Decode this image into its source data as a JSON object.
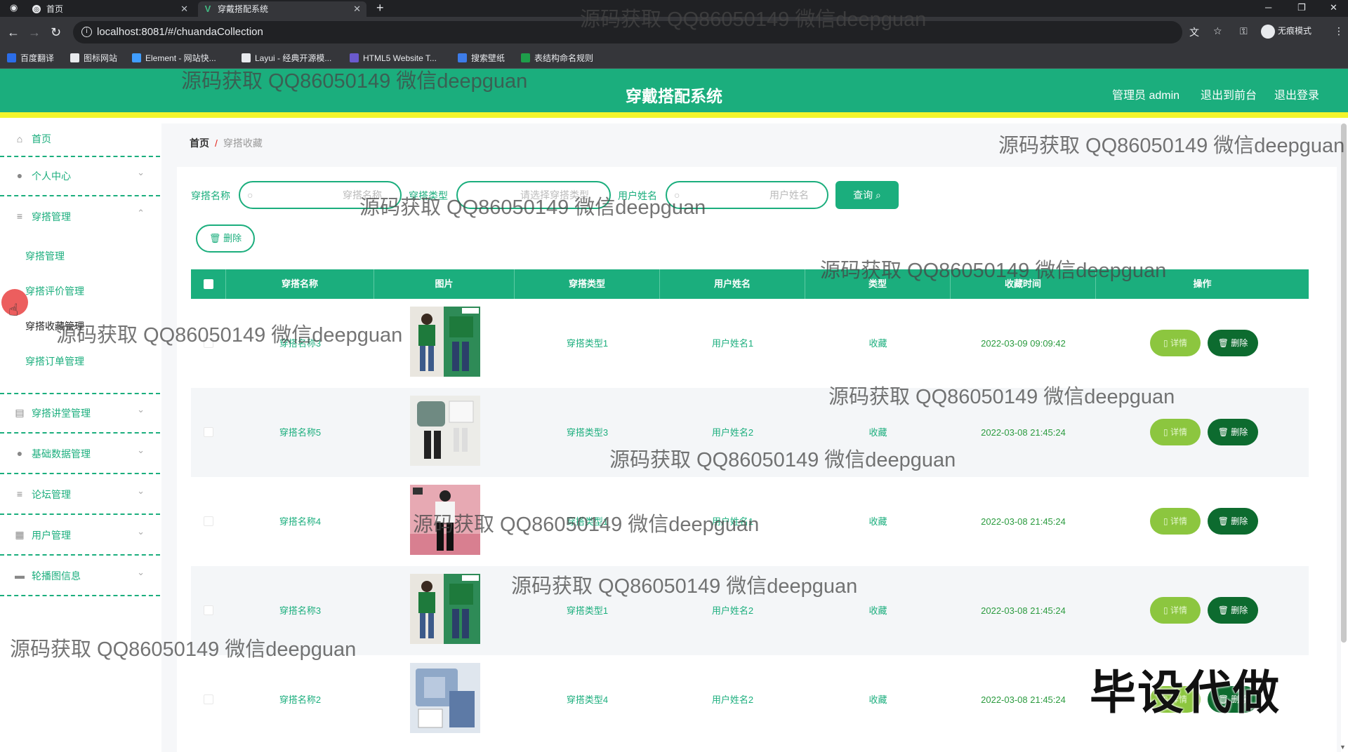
{
  "browser": {
    "tabs": [
      {
        "title": "首页",
        "active": false
      },
      {
        "title": "穿戴搭配系统",
        "active": true
      }
    ],
    "new_tab": "+",
    "window_controls": {
      "minimize": "─",
      "restore": "❐",
      "close": "✕"
    },
    "url": "localhost:8081/#/chuandaCollection",
    "incognito_label": "无痕模式",
    "bookmarks": [
      {
        "label": "百度翻译",
        "icon": "translate-icon",
        "color": "#2b6de8"
      },
      {
        "label": "图标网站",
        "icon": "flag-icon",
        "color": "#e8eaed"
      },
      {
        "label": "Element - 网站快...",
        "icon": "element-icon",
        "color": "#409eff"
      },
      {
        "label": "Layui - 经典开源模...",
        "icon": "layui-icon",
        "color": "#e8eaed"
      },
      {
        "label": "HTML5 Website T...",
        "icon": "html5-icon",
        "color": "#6a5acd"
      },
      {
        "label": "搜索壁纸",
        "icon": "wallpaper-icon",
        "color": "#3d7ce8"
      },
      {
        "label": "表结构命名规则",
        "icon": "sheet-icon",
        "color": "#1e9e4a"
      }
    ]
  },
  "header": {
    "title": "穿戴搭配系统",
    "user": "管理员 admin",
    "to_front": "退出到前台",
    "logout": "退出登录"
  },
  "sidebar": {
    "home": "首页",
    "personal": "个人中心",
    "outfit_mgmt": "穿搭管理",
    "sub": [
      "穿搭管理",
      "穿搭评价管理",
      "穿搭收藏管理",
      "穿搭订单管理"
    ],
    "lecture": "穿搭讲堂管理",
    "base_data": "基础数据管理",
    "forum": "论坛管理",
    "users": "用户管理",
    "carousel": "轮播图信息"
  },
  "breadcrumb": {
    "home": "首页",
    "sep": "/",
    "current": "穿搭收藏"
  },
  "filters": {
    "name_label": "穿搭名称",
    "name_placeholder": "穿搭名称",
    "type_label": "穿搭类型",
    "type_placeholder": "请选择穿搭类型",
    "user_label": "用户姓名",
    "user_placeholder": "用户姓名",
    "query": "查询",
    "batch_delete": "删除"
  },
  "table": {
    "columns": [
      "穿搭名称",
      "图片",
      "穿搭类型",
      "用户姓名",
      "类型",
      "收藏时间",
      "操作"
    ],
    "rows": [
      {
        "name": "穿搭名称3",
        "type": "穿搭类型1",
        "user": "用户姓名1",
        "kind": "收藏",
        "time": "2022-03-09 09:09:42",
        "photo": "green-outfit"
      },
      {
        "name": "穿搭名称5",
        "type": "穿搭类型3",
        "user": "用户姓名2",
        "kind": "收藏",
        "time": "2022-03-08 21:45:24",
        "photo": "jacket-outfit"
      },
      {
        "name": "穿搭名称4",
        "type": "穿搭类型1",
        "user": "用户姓名1",
        "kind": "收藏",
        "time": "2022-03-08 21:45:24",
        "photo": "pink-outfit"
      },
      {
        "name": "穿搭名称3",
        "type": "穿搭类型1",
        "user": "用户姓名2",
        "kind": "收藏",
        "time": "2022-03-08 21:45:24",
        "photo": "green-outfit"
      },
      {
        "name": "穿搭名称2",
        "type": "穿搭类型4",
        "user": "用户姓名2",
        "kind": "收藏",
        "time": "2022-03-08 21:45:24",
        "photo": "denim-outfit"
      }
    ],
    "detail_label": "详情",
    "delete_label": "删除"
  },
  "watermark": "源码获取 QQ86050149 微信deepguan",
  "stamp": "毕设代做",
  "colors": {
    "primary": "#1bae7d",
    "accent_bar": "#f2f52b",
    "detail_btn": "#8cc63f",
    "delete_btn": "#0d6b2f"
  }
}
